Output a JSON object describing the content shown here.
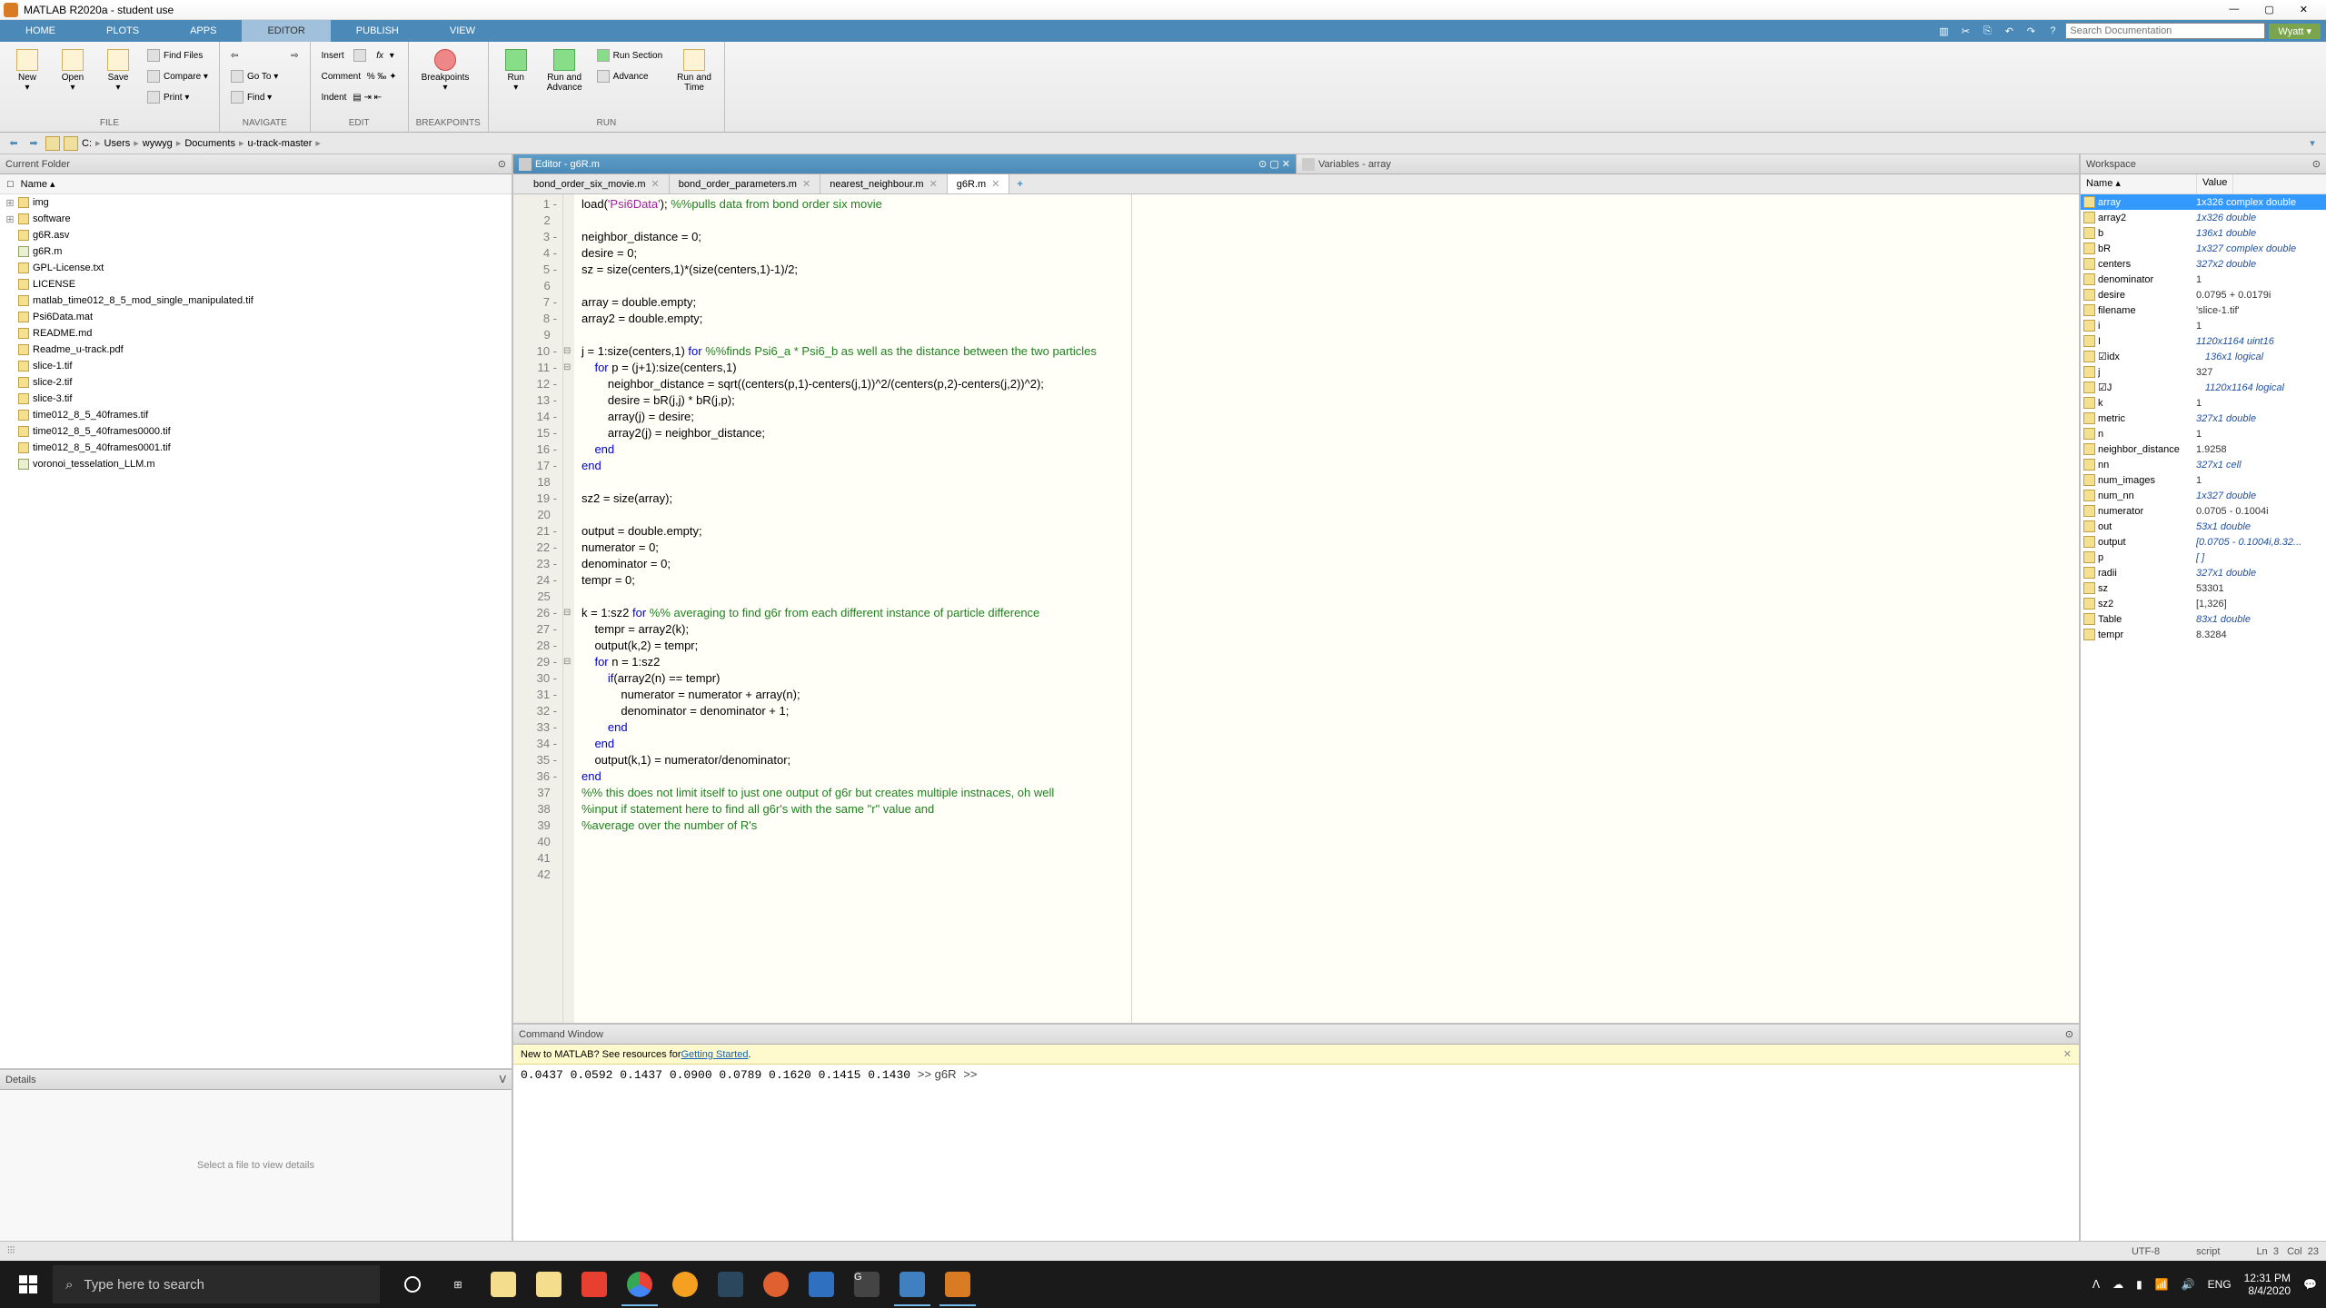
{
  "title_bar": {
    "title": "MATLAB R2020a - student use"
  },
  "ribbon": {
    "tabs": [
      "HOME",
      "PLOTS",
      "APPS",
      "EDITOR",
      "PUBLISH",
      "VIEW"
    ],
    "active_tab": 3,
    "search_placeholder": "Search Documentation",
    "user": "Wyatt ▾"
  },
  "toolstrip": {
    "groups": {
      "file": {
        "label": "FILE",
        "new": "New",
        "open": "Open",
        "save": "Save",
        "find_files": "Find Files",
        "compare": "Compare ▾",
        "print": "Print ▾"
      },
      "navigate": {
        "label": "NAVIGATE",
        "goto": "Go To ▾",
        "find": "Find ▾"
      },
      "edit": {
        "label": "EDIT",
        "insert": "Insert",
        "comment": "Comment",
        "indent": "Indent"
      },
      "breakpoints": {
        "label": "BREAKPOINTS",
        "btn": "Breakpoints"
      },
      "run": {
        "label": "RUN",
        "run": "Run",
        "run_advance": "Run and\nAdvance",
        "run_section": "Run Section",
        "advance": "Advance",
        "run_time": "Run and\nTime"
      }
    }
  },
  "breadcrumb": [
    "C:",
    "Users",
    "wywyg",
    "Documents",
    "u-track-master"
  ],
  "current_folder": {
    "title": "Current Folder",
    "col_name": "Name ▴",
    "files": [
      {
        "name": "img",
        "type": "folder"
      },
      {
        "name": "software",
        "type": "folder"
      },
      {
        "name": "g6R.asv",
        "type": "file"
      },
      {
        "name": "g6R.m",
        "type": "m"
      },
      {
        "name": "GPL-License.txt",
        "type": "file"
      },
      {
        "name": "LICENSE",
        "type": "file"
      },
      {
        "name": "matlab_time012_8_5_mod_single_manipulated.tif",
        "type": "file"
      },
      {
        "name": "Psi6Data.mat",
        "type": "file"
      },
      {
        "name": "README.md",
        "type": "file"
      },
      {
        "name": "Readme_u-track.pdf",
        "type": "file"
      },
      {
        "name": "slice-1.tif",
        "type": "file"
      },
      {
        "name": "slice-2.tif",
        "type": "file"
      },
      {
        "name": "slice-3.tif",
        "type": "file"
      },
      {
        "name": "time012_8_5_40frames.tif",
        "type": "file"
      },
      {
        "name": "time012_8_5_40frames0000.tif",
        "type": "file"
      },
      {
        "name": "time012_8_5_40frames0001.tif",
        "type": "file"
      },
      {
        "name": "voronoi_tesselation_LLM.m",
        "type": "m"
      }
    ]
  },
  "details": {
    "title": "Details",
    "empty": "Select a file to view details"
  },
  "editor": {
    "title": "Editor - g6R.m",
    "variables_title": "Variables - array",
    "tabs": [
      {
        "name": "bond_order_six_movie.m"
      },
      {
        "name": "bond_order_parameters.m"
      },
      {
        "name": "nearest_neighbour.m"
      },
      {
        "name": "g6R.m",
        "active": true
      }
    ],
    "code": [
      {
        "n": 1,
        "d": "-",
        "t": "load(",
        "s": "'Psi6Data'",
        "t2": "); ",
        "c": "%%pulls data from bond order six movie"
      },
      {
        "n": 2,
        "t": ""
      },
      {
        "n": 3,
        "d": "-",
        "t": "neighbor_distance = 0;"
      },
      {
        "n": 4,
        "d": "-",
        "t": "desire = 0;"
      },
      {
        "n": 5,
        "d": "-",
        "t": "sz = size(centers,1)*(size(centers,1)-1)/2;"
      },
      {
        "n": 6,
        "t": ""
      },
      {
        "n": 7,
        "d": "-",
        "t": "array = double.empty;"
      },
      {
        "n": 8,
        "d": "-",
        "t": "array2 = double.empty;"
      },
      {
        "n": 9,
        "t": ""
      },
      {
        "n": 10,
        "d": "-",
        "f": "⊟",
        "kw": "for ",
        "t": "j = 1:size(centers,1) ",
        "c": "%%finds Psi6_a * Psi6_b as well as the distance between the two particles"
      },
      {
        "n": 11,
        "d": "-",
        "f": "⊟",
        "t": "    ",
        "kw": "for ",
        "t2": "p = (j+1):size(centers,1)"
      },
      {
        "n": 12,
        "d": "-",
        "t": "        neighbor_distance = sqrt((centers(p,1)-centers(j,1))^2/(centers(p,2)-centers(j,2))^2);"
      },
      {
        "n": 13,
        "d": "-",
        "t": "        desire = bR(j,j) * bR(j,p);"
      },
      {
        "n": 14,
        "d": "-",
        "t": "        array(j) = desire;"
      },
      {
        "n": 15,
        "d": "-",
        "t": "        array2(j) = neighbor_distance;"
      },
      {
        "n": 16,
        "d": "-",
        "t": "    ",
        "kw": "end"
      },
      {
        "n": 17,
        "d": "-",
        "kw": "end"
      },
      {
        "n": 18,
        "t": ""
      },
      {
        "n": 19,
        "d": "-",
        "t": "sz2 = size(array);"
      },
      {
        "n": 20,
        "t": ""
      },
      {
        "n": 21,
        "d": "-",
        "t": "output = double.empty;"
      },
      {
        "n": 22,
        "d": "-",
        "t": "numerator = 0;"
      },
      {
        "n": 23,
        "d": "-",
        "t": "denominator = 0;"
      },
      {
        "n": 24,
        "d": "-",
        "t": "tempr = 0;"
      },
      {
        "n": 25,
        "t": ""
      },
      {
        "n": 26,
        "d": "-",
        "f": "⊟",
        "kw": "for ",
        "t": "k = 1:sz2 ",
        "c": "%% averaging to find g6r from each different instance of particle difference"
      },
      {
        "n": 27,
        "d": "-",
        "t": "    tempr = array2(k);"
      },
      {
        "n": 28,
        "d": "-",
        "t": "    output(k,2) = tempr;"
      },
      {
        "n": 29,
        "d": "-",
        "f": "⊟",
        "t": "    ",
        "kw": "for ",
        "t2": "n = 1:sz2"
      },
      {
        "n": 30,
        "d": "-",
        "t": "        ",
        "kw": "if",
        "t2": "(array2(n) == tempr)"
      },
      {
        "n": 31,
        "d": "-",
        "t": "            numerator = numerator + array(n);"
      },
      {
        "n": 32,
        "d": "-",
        "t": "            denominator = denominator + 1;"
      },
      {
        "n": 33,
        "d": "-",
        "t": "        ",
        "kw": "end"
      },
      {
        "n": 34,
        "d": "-",
        "t": "    ",
        "kw": "end"
      },
      {
        "n": 35,
        "d": "-",
        "t": "    output(k,1) = numerator/denominator;"
      },
      {
        "n": 36,
        "d": "-",
        "kw": "end"
      },
      {
        "n": 37,
        "c": "%% this does not limit itself to just one output of g6r but creates multiple instnaces, oh well"
      },
      {
        "n": 38,
        "c": "%input if statement here to find all g6r's with the same \"r\" value and "
      },
      {
        "n": 39,
        "c": "%average over the number of R's"
      },
      {
        "n": 40,
        "t": ""
      },
      {
        "n": 41,
        "t": ""
      },
      {
        "n": 42,
        "t": ""
      }
    ]
  },
  "command_window": {
    "title": "Command Window",
    "hint_prefix": "New to MATLAB? See resources for ",
    "hint_link": "Getting Started",
    "lines": [
      "    0.0437",
      "    0.0592",
      "    0.1437",
      "    0.0900",
      "    0.0789",
      "    0.1620",
      "    0.1415",
      "    0.1430",
      "",
      "",
      ">> g6R",
      ">> "
    ],
    "fx": "fx"
  },
  "workspace": {
    "title": "Workspace",
    "col_name": "Name ▴",
    "col_value": "Value",
    "vars": [
      {
        "n": "array",
        "v": "1x326 complex double",
        "sel": true
      },
      {
        "n": "array2",
        "v": "1x326 double",
        "i": true
      },
      {
        "n": "b",
        "v": "136x1 double",
        "i": true
      },
      {
        "n": "bR",
        "v": "1x327 complex double",
        "i": true
      },
      {
        "n": "centers",
        "v": "327x2 double",
        "i": true
      },
      {
        "n": "denominator",
        "v": "1"
      },
      {
        "n": "desire",
        "v": "0.0795 + 0.0179i"
      },
      {
        "n": "filename",
        "v": "'slice-1.tif'"
      },
      {
        "n": "i",
        "v": "1"
      },
      {
        "n": "I",
        "v": "1120x1164 uint16",
        "i": true
      },
      {
        "n": "idx",
        "v": "136x1 logical",
        "i": true,
        "chk": true
      },
      {
        "n": "j",
        "v": "327"
      },
      {
        "n": "J",
        "v": "1120x1164 logical",
        "i": true,
        "chk": true
      },
      {
        "n": "k",
        "v": "1"
      },
      {
        "n": "metric",
        "v": "327x1 double",
        "i": true
      },
      {
        "n": "n",
        "v": "1"
      },
      {
        "n": "neighbor_distance",
        "v": "1.9258"
      },
      {
        "n": "nn",
        "v": "327x1 cell",
        "i": true
      },
      {
        "n": "num_images",
        "v": "1"
      },
      {
        "n": "num_nn",
        "v": "1x327 double",
        "i": true
      },
      {
        "n": "numerator",
        "v": "0.0705 - 0.1004i"
      },
      {
        "n": "out",
        "v": "53x1 double",
        "i": true
      },
      {
        "n": "output",
        "v": "[0.0705 - 0.1004i,8.32...",
        "i": true
      },
      {
        "n": "p",
        "v": "[ ]",
        "i": true
      },
      {
        "n": "radii",
        "v": "327x1 double",
        "i": true
      },
      {
        "n": "sz",
        "v": "53301"
      },
      {
        "n": "sz2",
        "v": "[1,326]"
      },
      {
        "n": "Table",
        "v": "83x1 double",
        "i": true
      },
      {
        "n": "tempr",
        "v": "8.3284"
      }
    ]
  },
  "status": {
    "encoding": "UTF-8",
    "mode": "script",
    "ln": "Ln",
    "ln_v": "3",
    "col": "Col",
    "col_v": "23"
  },
  "taskbar": {
    "search_placeholder": "Type here to search",
    "time": "12:31 PM",
    "date": "8/4/2020"
  }
}
